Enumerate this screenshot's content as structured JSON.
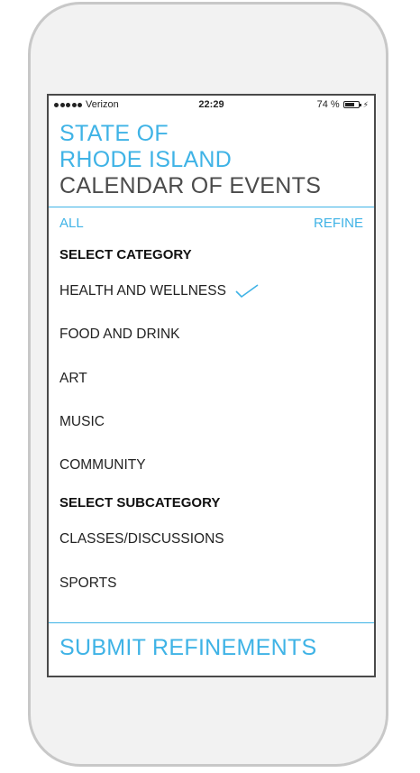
{
  "status_bar": {
    "carrier": "Verizon",
    "time": "22:29",
    "battery_percent_text": "74 %",
    "battery_level": 0.74
  },
  "header": {
    "title_line1": "STATE OF",
    "title_line2": "RHODE ISLAND",
    "title_line3": "CALENDAR OF EVENTS"
  },
  "tabs": {
    "all": "ALL",
    "refine": "REFINE"
  },
  "categories": {
    "heading": "SELECT CATEGORY",
    "items": [
      {
        "label": "HEALTH AND WELLNESS",
        "selected": true
      },
      {
        "label": "FOOD AND DRINK",
        "selected": false
      },
      {
        "label": "ART",
        "selected": false
      },
      {
        "label": "MUSIC",
        "selected": false
      },
      {
        "label": "COMMUNITY",
        "selected": false
      }
    ]
  },
  "subcategories": {
    "heading": "SELECT SUBCATEGORY",
    "items": [
      {
        "label": "CLASSES/DISCUSSIONS",
        "selected": false
      },
      {
        "label": "SPORTS",
        "selected": false
      }
    ]
  },
  "footer": {
    "submit_label": "SUBMIT REFINEMENTS"
  },
  "colors": {
    "accent": "#3fb3e6",
    "text": "#222222"
  }
}
